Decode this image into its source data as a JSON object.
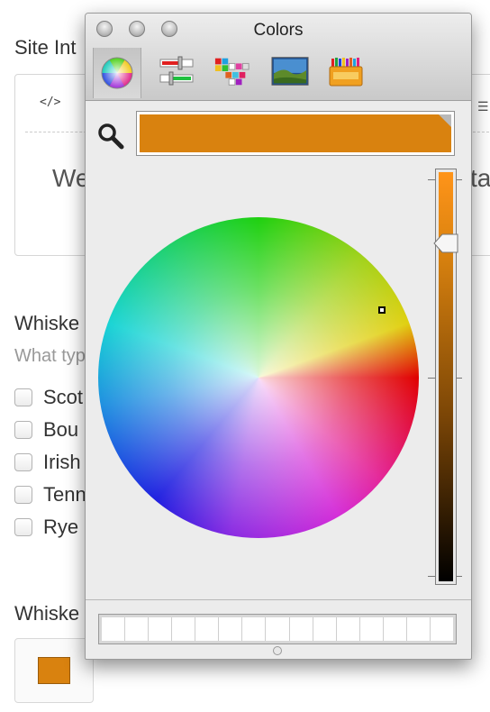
{
  "background_form": {
    "site_intro_label": "Site Int",
    "code_button_label": "</>",
    "editor_text_left": "We",
    "editor_text_right": "ta",
    "whiskey_types_label": "Whiske",
    "whiskey_types_hint": "What typ",
    "checkbox_options": [
      {
        "label": "Scot",
        "checked": false
      },
      {
        "label": "Bou",
        "checked": false
      },
      {
        "label": "Irish",
        "checked": false
      },
      {
        "label": "Tenn",
        "checked": false
      },
      {
        "label": "Rye",
        "checked": false
      }
    ],
    "whiskey_color_label": "Whiske",
    "selected_color": "#d9820f"
  },
  "colors_panel": {
    "title": "Colors",
    "toolbar": [
      {
        "name": "color-wheel",
        "selected": true
      },
      {
        "name": "color-sliders",
        "selected": false
      },
      {
        "name": "color-palettes",
        "selected": false
      },
      {
        "name": "image-palettes",
        "selected": false
      },
      {
        "name": "crayons",
        "selected": false
      }
    ],
    "current_color": "#d9820f",
    "brightness_level": 0.82,
    "swatch_slots": 15
  }
}
